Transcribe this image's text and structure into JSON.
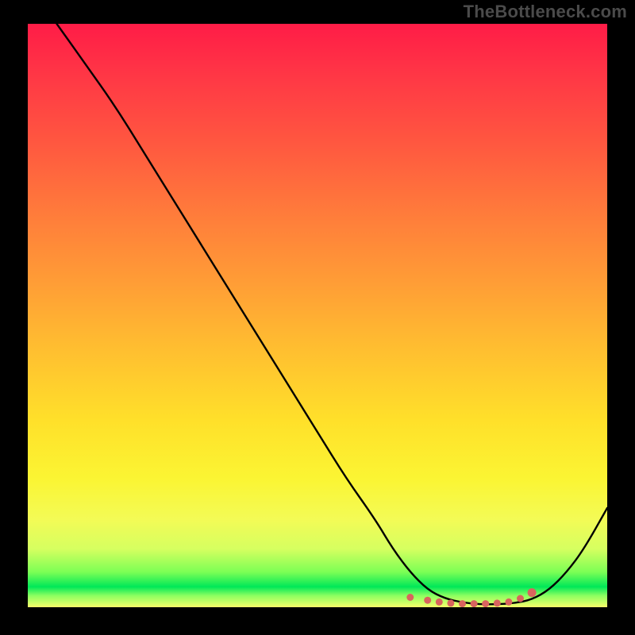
{
  "watermark": "TheBottleneck.com",
  "chart_data": {
    "type": "line",
    "title": "",
    "xlabel": "",
    "ylabel": "",
    "xlim": [
      0,
      100
    ],
    "ylim": [
      0,
      100
    ],
    "grid": false,
    "series": [
      {
        "name": "curve",
        "color": "#000000",
        "x": [
          5,
          10,
          15,
          20,
          25,
          30,
          35,
          40,
          45,
          50,
          55,
          60,
          63,
          66,
          69,
          72,
          75,
          78,
          81,
          84,
          87,
          90,
          93,
          96,
          100
        ],
        "values": [
          100,
          93,
          86,
          78,
          70,
          62,
          54,
          46,
          38,
          30,
          22,
          15,
          10,
          6,
          3,
          1.5,
          0.8,
          0.5,
          0.5,
          0.7,
          1.3,
          3,
          6,
          10,
          17
        ]
      },
      {
        "name": "near-zero-markers",
        "color": "#d9645e",
        "x": [
          66,
          69,
          71,
          73,
          75,
          77,
          79,
          81,
          83,
          85,
          87
        ],
        "values": [
          1.7,
          1.2,
          0.9,
          0.7,
          0.6,
          0.6,
          0.6,
          0.7,
          0.9,
          1.5,
          2.5
        ]
      }
    ],
    "gradient_stops": [
      {
        "pos": 0,
        "color": "#ff1c47"
      },
      {
        "pos": 0.35,
        "color": "#ff8a38"
      },
      {
        "pos": 0.7,
        "color": "#ffe52c"
      },
      {
        "pos": 0.9,
        "color": "#c8ff55"
      },
      {
        "pos": 0.965,
        "color": "#00e858"
      },
      {
        "pos": 1.0,
        "color": "#f7ff6a"
      }
    ]
  }
}
